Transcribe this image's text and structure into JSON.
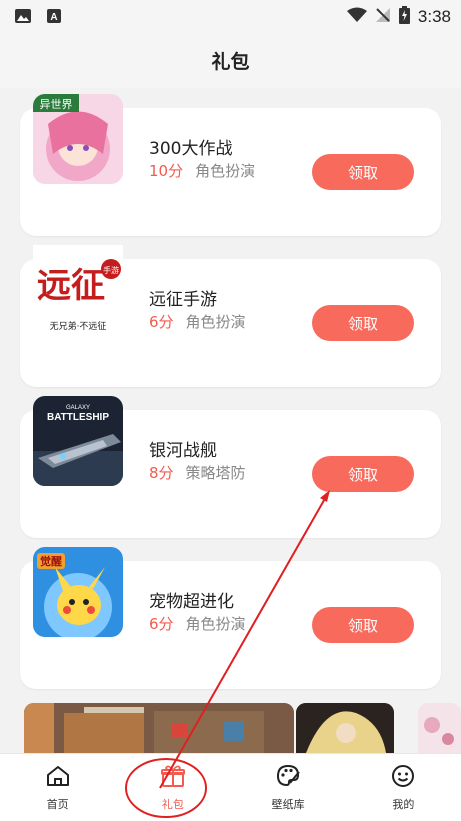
{
  "status_bar": {
    "time": "3:38"
  },
  "page_title": "礼包",
  "gifts": [
    {
      "name": "300大作战",
      "score": "10分",
      "genre": "角色扮演",
      "button": "领取",
      "thumb_text": "异世界"
    },
    {
      "name": "远征手游",
      "score": "6分",
      "genre": "角色扮演",
      "button": "领取",
      "thumb_text": "远征",
      "thumb_tag": "手游",
      "thumb_caption": "无兄弟·不远征"
    },
    {
      "name": "银河战舰",
      "score": "8分",
      "genre": "策略塔防",
      "button": "领取",
      "thumb_text": "GALAXY",
      "thumb_text2": "BATTLESHIP"
    },
    {
      "name": "宠物超进化",
      "score": "6分",
      "genre": "角色扮演",
      "button": "领取",
      "thumb_text": "觉醒"
    }
  ],
  "tabs": [
    {
      "label": "首页",
      "icon": "home-icon"
    },
    {
      "label": "礼包",
      "icon": "gift-icon"
    },
    {
      "label": "壁纸库",
      "icon": "palette-icon"
    },
    {
      "label": "我的",
      "icon": "smiley-icon"
    }
  ],
  "colors": {
    "accent": "#f86a5c",
    "score": "#f25b4f",
    "annotation": "#e02020"
  }
}
